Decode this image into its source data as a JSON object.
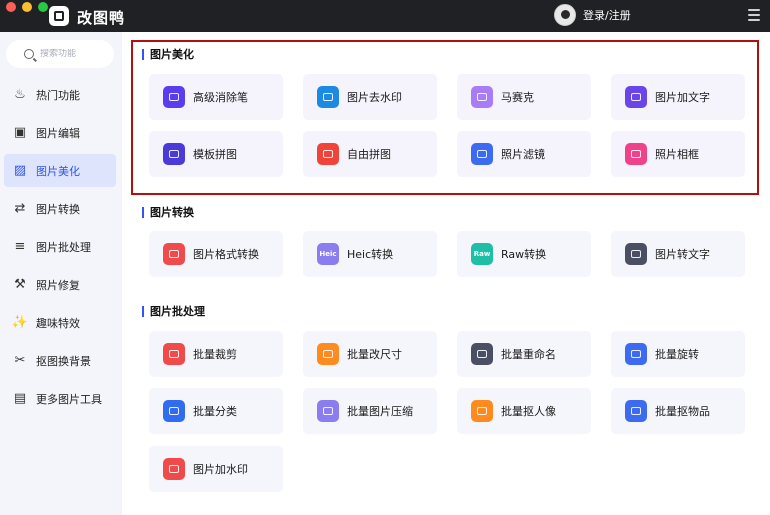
{
  "app": {
    "name": "改图鸭",
    "login_text": "登录/注册"
  },
  "search": {
    "placeholder": "搜索功能"
  },
  "sidebar": {
    "items": [
      {
        "label": "热门功能",
        "icon": "fire-icon"
      },
      {
        "label": "图片编辑",
        "icon": "image-edit-icon"
      },
      {
        "label": "图片美化",
        "icon": "image-beautify-icon",
        "active": true
      },
      {
        "label": "图片转换",
        "icon": "image-convert-icon"
      },
      {
        "label": "图片批处理",
        "icon": "batch-icon"
      },
      {
        "label": "照片修复",
        "icon": "photo-repair-icon"
      },
      {
        "label": "趣味特效",
        "icon": "sparkle-icon"
      },
      {
        "label": "抠图换背景",
        "icon": "cutout-icon"
      },
      {
        "label": "更多图片工具",
        "icon": "toolbox-icon"
      }
    ]
  },
  "sections": [
    {
      "title": "图片美化",
      "cards": [
        {
          "label": "高级消除笔",
          "icon": "eraser-pen-icon",
          "color": "#5b3df0"
        },
        {
          "label": "图片去水印",
          "icon": "water-drop-icon",
          "color": "#1e88e5"
        },
        {
          "label": "马赛克",
          "icon": "mosaic-icon",
          "color": "#a77cf5"
        },
        {
          "label": "图片加文字",
          "icon": "add-text-icon",
          "color": "#6a45e8"
        },
        {
          "label": "模板拼图",
          "icon": "template-collage-icon",
          "color": "#4a3bd8"
        },
        {
          "label": "自由拼图",
          "icon": "free-collage-icon",
          "color": "#f0433a"
        },
        {
          "label": "照片滤镜",
          "icon": "filter-icon",
          "color": "#3d6bf0"
        },
        {
          "label": "照片相框",
          "icon": "photo-frame-icon",
          "color": "#f0428a"
        }
      ]
    },
    {
      "title": "图片转换",
      "cards": [
        {
          "label": "图片格式转换",
          "icon": "format-convert-icon",
          "color": "#f04a4a"
        },
        {
          "label": "Heic转换",
          "icon": "heic-icon",
          "color": "#8a7df0",
          "badge": "Heic"
        },
        {
          "label": "Raw转换",
          "icon": "raw-icon",
          "color": "#1fbfa6",
          "badge": "Raw"
        },
        {
          "label": "图片转文字",
          "icon": "image-to-text-icon",
          "color": "#4a4f63"
        }
      ]
    },
    {
      "title": "图片批处理",
      "cards": [
        {
          "label": "批量裁剪",
          "icon": "batch-crop-icon",
          "color": "#f04a4a"
        },
        {
          "label": "批量改尺寸",
          "icon": "batch-resize-icon",
          "color": "#ff8a1f"
        },
        {
          "label": "批量重命名",
          "icon": "batch-rename-icon",
          "color": "#4a4f63"
        },
        {
          "label": "批量旋转",
          "icon": "batch-rotate-icon",
          "color": "#3d6bf0"
        },
        {
          "label": "批量分类",
          "icon": "batch-classify-icon",
          "color": "#2f6cf0"
        },
        {
          "label": "批量图片压缩",
          "icon": "batch-compress-icon",
          "color": "#8a7df0"
        },
        {
          "label": "批量抠人像",
          "icon": "batch-portrait-cutout-icon",
          "color": "#ff8a1f"
        },
        {
          "label": "批量抠物品",
          "icon": "batch-object-cutout-icon",
          "color": "#3d6bf0"
        },
        {
          "label": "图片加水印",
          "icon": "add-watermark-icon",
          "color": "#f04a4a"
        }
      ]
    }
  ]
}
